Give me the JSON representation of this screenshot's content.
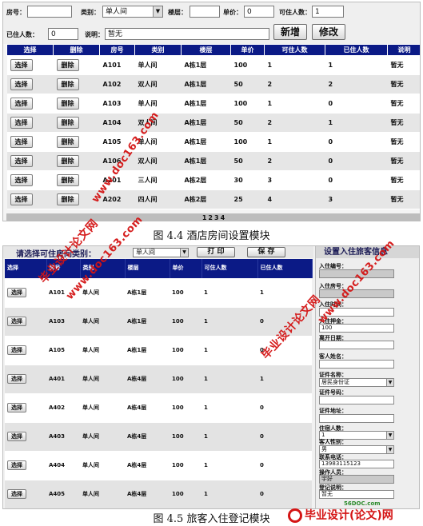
{
  "room_setup": {
    "form": {
      "room_no_label": "房号：",
      "room_no_value": "",
      "type_label": "类别：",
      "type_value": "单人间",
      "floor_label": "楼层：",
      "floor_value": "",
      "price_label": "单价：",
      "price_value": "0",
      "capacity_label": "可住人数：",
      "capacity_value": "1",
      "occupied_label": "已住人数：",
      "occupied_value": "0",
      "note_label": "说明：",
      "note_value": "暂无",
      "add_button": "新增",
      "edit_button": "修改"
    },
    "columns": [
      "选择",
      "删除",
      "房号",
      "类别",
      "楼层",
      "单价",
      "可住人数",
      "已住人数",
      "说明"
    ],
    "select_label": "选择",
    "delete_label": "删除",
    "rows": [
      {
        "room": "A101",
        "type": "单人间",
        "floor": "A栋1层",
        "price": "100",
        "capacity": "1",
        "occupied": "1",
        "note": "暂无"
      },
      {
        "room": "A102",
        "type": "双人间",
        "floor": "A栋1层",
        "price": "50",
        "capacity": "2",
        "occupied": "2",
        "note": "暂无"
      },
      {
        "room": "A103",
        "type": "单人间",
        "floor": "A栋1层",
        "price": "100",
        "capacity": "1",
        "occupied": "0",
        "note": "暂无"
      },
      {
        "room": "A104",
        "type": "双人间",
        "floor": "A栋1层",
        "price": "50",
        "capacity": "2",
        "occupied": "1",
        "note": "暂无"
      },
      {
        "room": "A105",
        "type": "单人间",
        "floor": "A栋1层",
        "price": "100",
        "capacity": "1",
        "occupied": "0",
        "note": "暂无"
      },
      {
        "room": "A106",
        "type": "双人间",
        "floor": "A栋1层",
        "price": "50",
        "capacity": "2",
        "occupied": "0",
        "note": "暂无"
      },
      {
        "room": "A201",
        "type": "三人间",
        "floor": "A栋2层",
        "price": "30",
        "capacity": "3",
        "occupied": "0",
        "note": "暂无"
      },
      {
        "room": "A202",
        "type": "四人间",
        "floor": "A栋2层",
        "price": "25",
        "capacity": "4",
        "occupied": "3",
        "note": "暂无"
      }
    ],
    "pages": [
      "1",
      "2",
      "3",
      "4"
    ]
  },
  "caption1": "图 4.4 酒店房间设置模块",
  "checkin": {
    "query_label": "请选择可住房间类别：",
    "type_value": "单人间",
    "print_button": "打 印",
    "save_button": "保 存",
    "columns": [
      "选择",
      "房号",
      "类别",
      "楼层",
      "单价",
      "可住人数",
      "已住人数"
    ],
    "select_label": "选择",
    "rows": [
      {
        "room": "A101",
        "type": "单人间",
        "floor": "A栋1层",
        "price": "100",
        "capacity": "1",
        "occupied": "1"
      },
      {
        "room": "A103",
        "type": "单人间",
        "floor": "A栋1层",
        "price": "100",
        "capacity": "1",
        "occupied": "0"
      },
      {
        "room": "A105",
        "type": "单人间",
        "floor": "A栋1层",
        "price": "100",
        "capacity": "1",
        "occupied": "0"
      },
      {
        "room": "A401",
        "type": "单人间",
        "floor": "A栋4层",
        "price": "100",
        "capacity": "1",
        "occupied": "1"
      },
      {
        "room": "A402",
        "type": "单人间",
        "floor": "A栋4层",
        "price": "100",
        "capacity": "1",
        "occupied": "0"
      },
      {
        "room": "A403",
        "type": "单人间",
        "floor": "A栋4层",
        "price": "100",
        "capacity": "1",
        "occupied": "0"
      },
      {
        "room": "A404",
        "type": "单人间",
        "floor": "A栋4层",
        "price": "100",
        "capacity": "1",
        "occupied": "0"
      },
      {
        "room": "A405",
        "type": "单人间",
        "floor": "A栋4层",
        "price": "100",
        "capacity": "1",
        "occupied": "0"
      }
    ],
    "side": {
      "title": "设置入住旅客信息",
      "checkin_no_label": "入住编号：",
      "checkin_no_value": "",
      "room_label": "入住房号：",
      "room_value": "",
      "time_label": "入住时间：",
      "time_value": "",
      "deposit_label": "入住押金：",
      "deposit_value": "100",
      "leave_label": "离开日期：",
      "leave_value": "",
      "name_label": "客人姓名：",
      "name_value": "",
      "id_type_label": "证件名称：",
      "id_type_value": "居民身份证",
      "id_no_label": "证件号码：",
      "id_no_value": "",
      "id_addr_label": "证件地址：",
      "id_addr_value": "",
      "people_label": "住宿人数：",
      "people_value": "1",
      "gender_label": "客人性别：",
      "gender_value": "男",
      "phone_label": "联系电话：",
      "phone_value": "13983115123",
      "operator_label": "操作人员：",
      "operator_value": "宇好",
      "note_label": "登记说明：",
      "note_value": "暂无"
    }
  },
  "caption2": "图 4.5 旅客入住登记模块",
  "watermark": {
    "site_text": "www.doc163.com",
    "school_text": "毕业设计论文网",
    "logo_text": "毕业设计(论文)网",
    "logo_small": "56DOC.com"
  }
}
